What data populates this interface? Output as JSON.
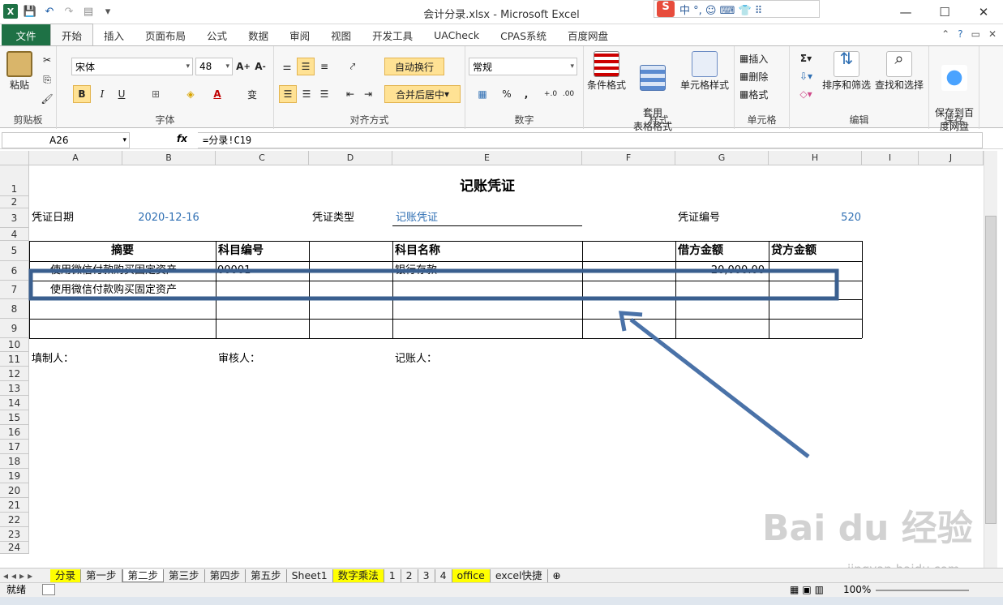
{
  "window": {
    "title": "会计分录.xlsx - Microsoft Excel"
  },
  "ime": {
    "logo": "S",
    "items": "中 °, ☺ ⌨ 👕 ⠿"
  },
  "ribbon_tabs": [
    "文件",
    "开始",
    "插入",
    "页面布局",
    "公式",
    "数据",
    "审阅",
    "视图",
    "开发工具",
    "UACheck",
    "CPAS系统",
    "百度网盘"
  ],
  "clipboard": {
    "paste": "粘贴",
    "label": "剪贴板"
  },
  "font": {
    "name": "宋体",
    "size": "48",
    "bold": "B",
    "italic": "I",
    "underline": "U",
    "label": "字体"
  },
  "alignment": {
    "wrap": "自动换行",
    "merge": "合并后居中",
    "label": "对齐方式"
  },
  "number": {
    "format": "常规",
    "percent": "%",
    "comma": ",",
    "label": "数字"
  },
  "styles": {
    "cond": "条件格式",
    "table": "套用\n表格格式",
    "cell": "单元格样式",
    "label": "样式"
  },
  "cells": {
    "insert": "插入",
    "delete": "删除",
    "format": "格式",
    "label": "单元格"
  },
  "editing": {
    "sort": "排序和筛选",
    "find": "查找和选择",
    "label": "编辑"
  },
  "save": {
    "btn": "保存到百\n度网盘",
    "label": "保存"
  },
  "formula_bar": {
    "name_box": "A26",
    "fx": "fx",
    "formula": "=分录!C19"
  },
  "columns": [
    "A",
    "B",
    "C",
    "D",
    "E",
    "F",
    "G",
    "H",
    "I",
    "J"
  ],
  "rows": [
    "1",
    "2",
    "3",
    "4",
    "5",
    "6",
    "7",
    "8",
    "9",
    "10",
    "11",
    "12",
    "13",
    "14",
    "15",
    "16",
    "17",
    "18",
    "19",
    "20",
    "21",
    "22",
    "23",
    "24"
  ],
  "sheet": {
    "title": "记账凭证",
    "date_label": "凭证日期",
    "date_value": "2020-12-16",
    "type_label": "凭证类型",
    "type_value": "记账凭证",
    "no_label": "凭证编号",
    "no_value": "520",
    "headers": [
      "摘要",
      "科目编号",
      "科目名称",
      "借方金额",
      "贷方金额"
    ],
    "row6": {
      "summary": "使用微信付款购买固定资产",
      "code": "00001",
      "name": "银行存款",
      "debit": "20,000.00"
    },
    "row7": {
      "summary": "使用微信付款购买固定资产"
    },
    "preparer": "填制人：",
    "reviewer": "审核人：",
    "bookkeeper": "记账人："
  },
  "sheet_tabs": [
    "分录",
    "第一步",
    "第二步",
    "第三步",
    "第四步",
    "第五步",
    "Sheet1",
    "数字乘法",
    "1",
    "2",
    "3",
    "4",
    "office",
    "excel快捷"
  ],
  "status": {
    "ready": "就绪",
    "zoom": "100%"
  },
  "watermark": {
    "main": "Bai du 经验",
    "sub": "jingyan.baidu.com"
  },
  "accent": "#1e7145",
  "annotation_color": "#3a5f8f"
}
